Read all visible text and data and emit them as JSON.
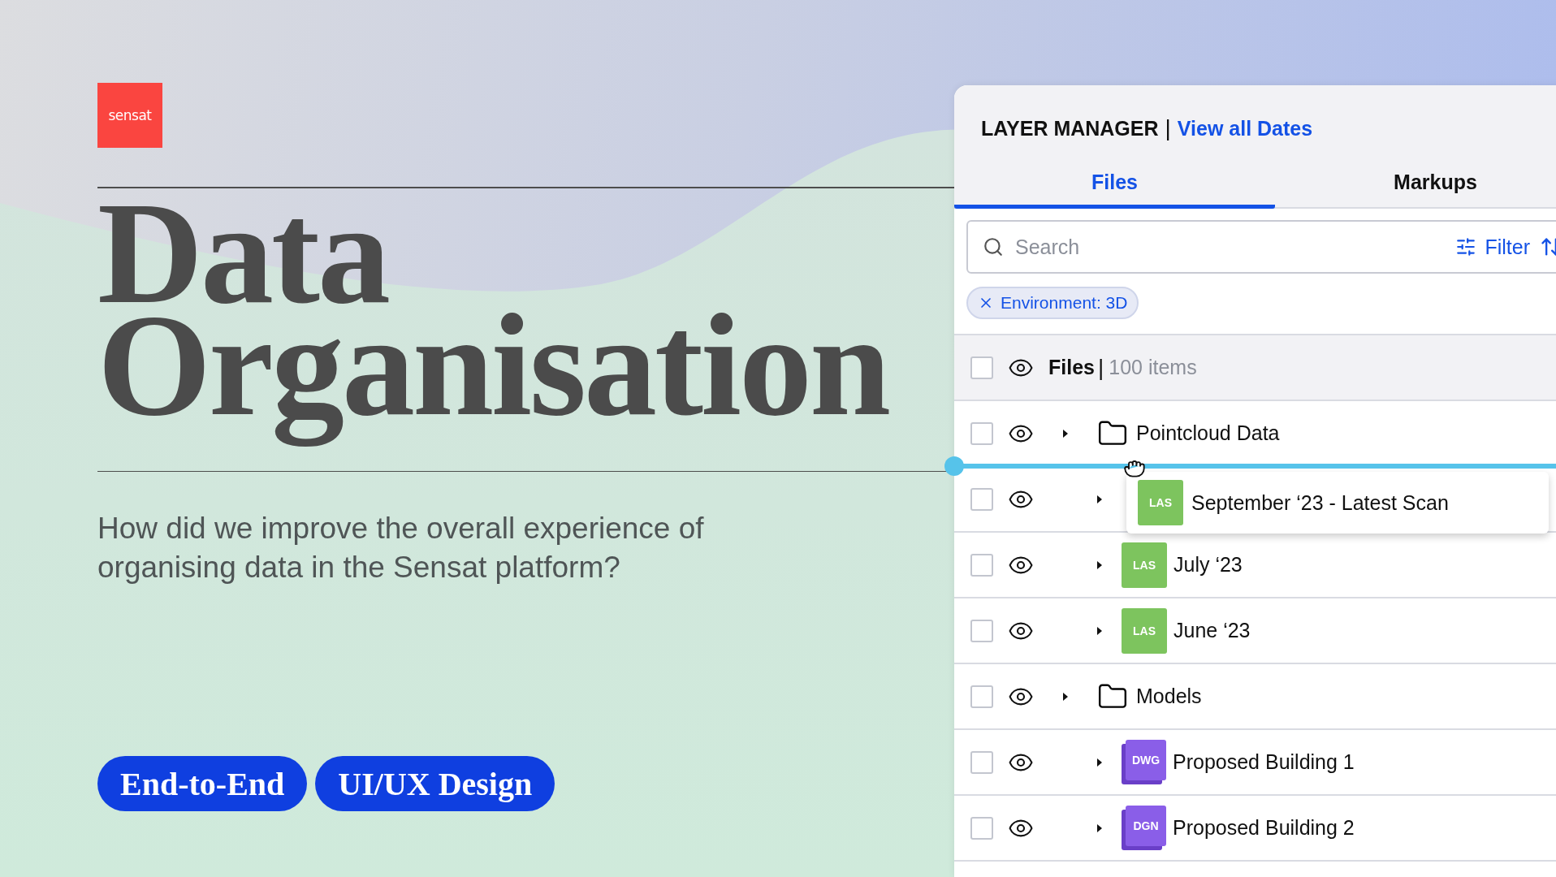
{
  "brand": {
    "logo": "sensat"
  },
  "hero": {
    "title_lines": [
      "Data",
      "Organisation"
    ],
    "subtitle": "How did we improve the overall experience of organising data in the Sensat platform?",
    "tags": [
      "End-to-End",
      "UI/UX Design"
    ]
  },
  "layer_manager": {
    "title": "LAYER MANAGER",
    "separator": "|",
    "link": "View all Dates",
    "tabs": [
      {
        "label": "Files",
        "selected": true
      },
      {
        "label": "Markups",
        "selected": false
      }
    ],
    "search": {
      "placeholder": "Search"
    },
    "filter_button": "Filter",
    "chips": [
      {
        "label": "Environment: 3D"
      }
    ],
    "header": {
      "label": "Files",
      "separator": "|",
      "count": "100 items",
      "checked": false,
      "visible": true
    },
    "tree": [
      {
        "kind": "folder",
        "name": "Pointcloud Data",
        "checked": false,
        "visible": true,
        "children": [
          {
            "kind": "scan",
            "type": "LAS",
            "color": "#7dc45e",
            "name": "September ‘23 - Latest Scan",
            "checked": false,
            "visible": true,
            "dragging": true
          },
          {
            "kind": "scan",
            "type": "LAS",
            "color": "#7dc45e",
            "name": "July ‘23",
            "checked": false,
            "visible": true,
            "dragging": false
          },
          {
            "kind": "scan",
            "type": "LAS",
            "color": "#7dc45e",
            "name": "June ‘23",
            "checked": false,
            "visible": true,
            "dragging": false
          }
        ]
      },
      {
        "kind": "folder",
        "name": "Models",
        "checked": false,
        "visible": true,
        "children": [
          {
            "kind": "model",
            "type": "DWG",
            "color": "#8a5ee8",
            "name": "Proposed Building 1",
            "checked": false,
            "visible": true,
            "dragging": false
          },
          {
            "kind": "model",
            "type": "DGN",
            "color": "#8a5ee8",
            "name": "Proposed Building 2",
            "checked": false,
            "visible": true,
            "dragging": false
          }
        ]
      }
    ]
  }
}
